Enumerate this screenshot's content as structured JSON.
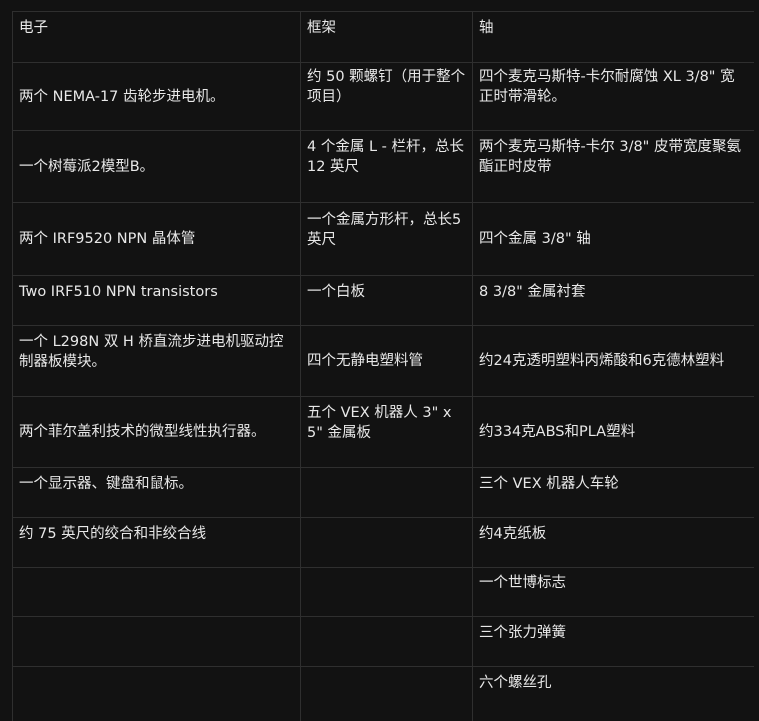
{
  "table": {
    "headers": [
      "电子",
      "框架",
      "轴"
    ],
    "rows": [
      [
        "两个 NEMA-17 齿轮步进电机。",
        "约 50 颗螺钉（用于整个项目）",
        "四个麦克马斯特-卡尔耐腐蚀 XL 3/8\" 宽正时带滑轮。"
      ],
      [
        "一个树莓派2模型B。",
        "4 个金属 L - 栏杆，总长 12 英尺",
        "两个麦克马斯特-卡尔 3/8\" 皮带宽度聚氨酯正时皮带"
      ],
      [
        "两个 IRF9520 NPN 晶体管",
        "一个金属方形杆，总长5英尺",
        "四个金属 3/8\" 轴"
      ],
      [
        "Two IRF510 NPN transistors",
        "一个白板",
        "8 3/8\" 金属衬套"
      ],
      [
        "一个 L298N 双 H 桥直流步进电机驱动控制器板模块。",
        "四个无静电塑料管",
        "约24克透明塑料丙烯酸和6克德林塑料"
      ],
      [
        "两个菲尔盖利技术的微型线性执行器。",
        "五个 VEX 机器人 3\" x 5\" 金属板",
        "约334克ABS和PLA塑料"
      ],
      [
        "一个显示器、键盘和鼠标。",
        "",
        "三个 VEX 机器人车轮"
      ],
      [
        "约 75 英尺的绞合和非绞合线",
        "",
        "约4克纸板"
      ],
      [
        "",
        "",
        "一个世博标志"
      ],
      [
        "",
        "",
        "三个张力弹簧"
      ],
      [
        "",
        "",
        "六个螺丝孔"
      ]
    ]
  }
}
